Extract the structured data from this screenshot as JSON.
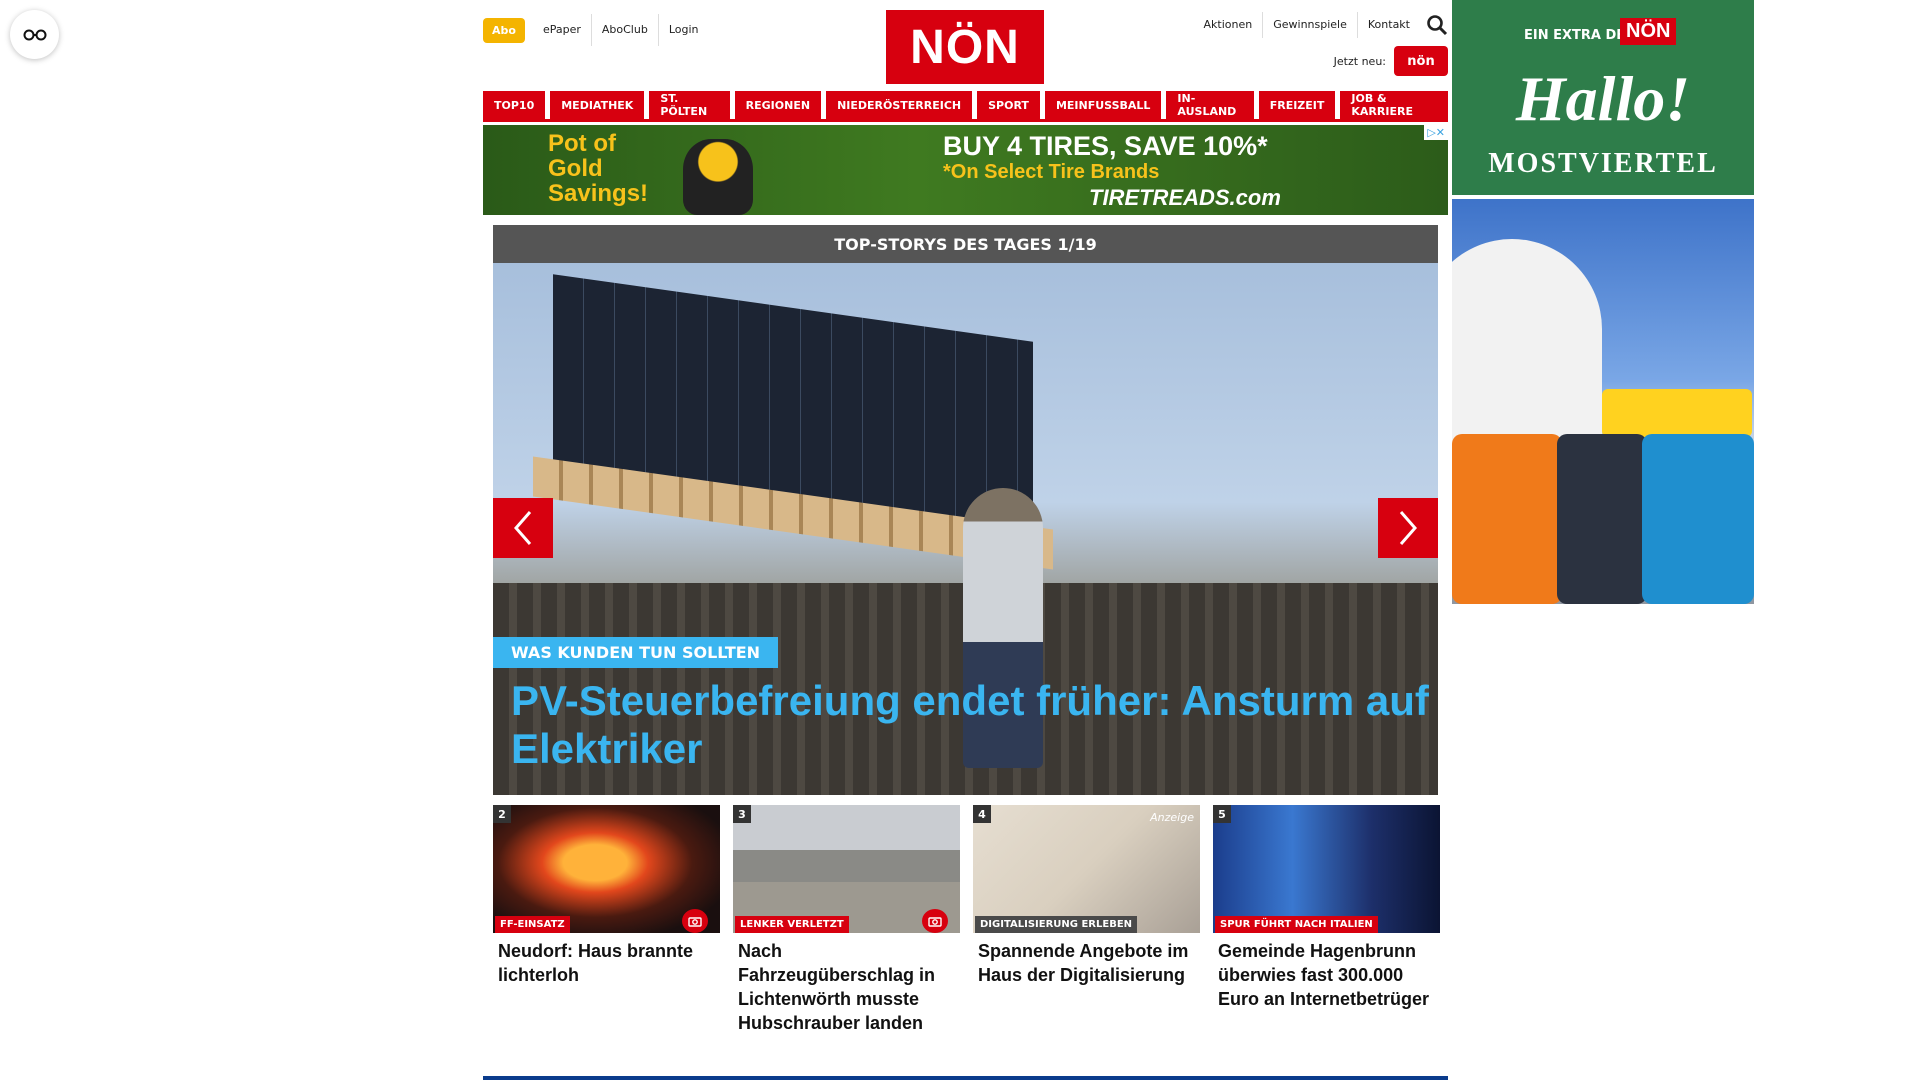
{
  "header": {
    "abo_label": "Abo",
    "left_links": [
      "ePaper",
      "AboClub",
      "Login"
    ],
    "logo_text": "NÖN",
    "right_links": [
      "Aktionen",
      "Gewinnspiele",
      "Kontakt"
    ],
    "jetzt_neu_label": "Jetzt neu:",
    "jetzt_neu_badge": "nön"
  },
  "menu": [
    "TOP10",
    "MEDIATHEK",
    "ST. PÖLTEN",
    "REGIONEN",
    "NIEDERÖSTERREICH",
    "SPORT",
    "MEINFUSSBALL",
    "IN-AUSLAND",
    "FREIZEIT",
    "JOB & KARRIERE"
  ],
  "banner_ad": {
    "left_text": [
      "Pot of",
      "Gold",
      "Savings!"
    ],
    "headline": "BUY 4 TIRES, SAVE 10%*",
    "sub": "*On Select Tire Brands",
    "brand": "TIRETREADS.com"
  },
  "slider": {
    "heading": "TOP-STORYS DES TAGES 1/19",
    "kicker": "WAS KUNDEN TUN SOLLTEN",
    "title": "PV-Steuerbefreiung endet früher: Ansturm auf Elektriker"
  },
  "cards": [
    {
      "num": "2",
      "label": "FF-EINSATZ",
      "title": "Neudorf: Haus brannte lichterloh",
      "camera": true
    },
    {
      "num": "3",
      "label": "LENKER VERLETZT",
      "title": "Nach Fahrzeugüberschlag in Lichtenwörth musste Hubschrauber landen",
      "camera": true
    },
    {
      "num": "4",
      "label": "DIGITALISIERUNG ERLEBEN",
      "title": "Spannende Angebote im Haus der Digitalisierung",
      "camera": false,
      "anzeige": "Anzeige"
    },
    {
      "num": "5",
      "label": "SPUR FÜHRT NACH ITALIEN",
      "title": "Gemeinde Hagenbrunn überwies fast 300.000 Euro an Internetbetrüger",
      "camera": false
    }
  ],
  "sky_ad": {
    "extra_text": "EIN EXTRA DER",
    "non": "NÖN",
    "hallo": "Hallo!",
    "region": "MOSTVIERTEL"
  },
  "colors": {
    "brand_red": "#d7000f",
    "abo_yellow": "#f4b400",
    "kicker_blue": "#3ab5f0"
  }
}
